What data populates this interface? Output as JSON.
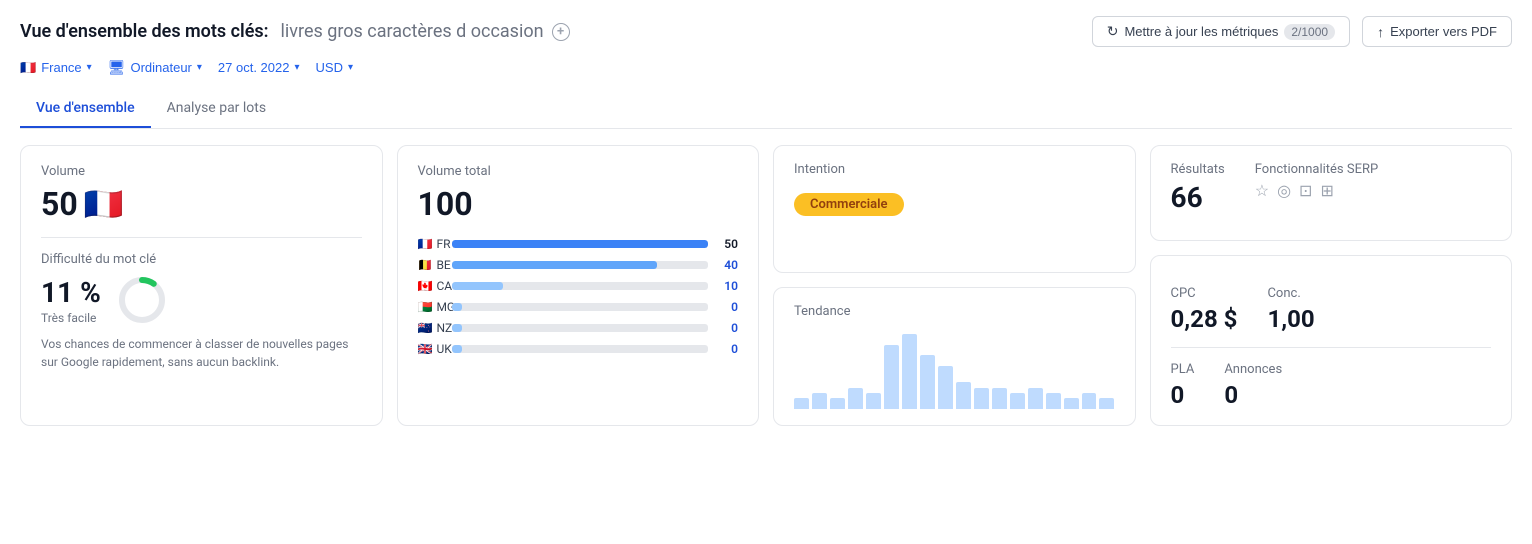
{
  "header": {
    "title_label": "Vue d'ensemble des mots clés:",
    "keyword_query": "livres gros caractères d occasion",
    "update_btn_label": "Mettre à jour les métriques",
    "update_count": "2/1000",
    "export_btn_label": "Exporter vers PDF"
  },
  "filters": {
    "country_label": "France",
    "device_label": "Ordinateur",
    "date_label": "27 oct. 2022",
    "currency_label": "USD"
  },
  "tabs": [
    {
      "id": "overview",
      "label": "Vue d'ensemble",
      "active": true
    },
    {
      "id": "batch",
      "label": "Analyse par lots",
      "active": false
    }
  ],
  "volume_card": {
    "label": "Volume",
    "value": "50"
  },
  "difficulty_card": {
    "label": "Difficulté du mot clé",
    "value": "11 %",
    "sub": "Très facile",
    "description": "Vos chances de commencer à classer de nouvelles pages sur Google rapidement, sans aucun backlink.",
    "percent": 11
  },
  "volume_total_card": {
    "label": "Volume total",
    "value": "100",
    "bars": [
      {
        "code": "FR",
        "flag": "🇫🇷",
        "value": 50,
        "max": 50,
        "num": "50",
        "color": "blue"
      },
      {
        "code": "BE",
        "flag": "🇧🇪",
        "value": 40,
        "max": 50,
        "num": "40",
        "color": "be"
      },
      {
        "code": "CA",
        "flag": "🇨🇦",
        "value": 10,
        "max": 50,
        "num": "10",
        "color": "ca"
      },
      {
        "code": "MG",
        "flag": "🇲🇬",
        "value": 2,
        "max": 50,
        "num": "0",
        "color": "mg"
      },
      {
        "code": "NZ",
        "flag": "🇳🇿",
        "value": 2,
        "max": 50,
        "num": "0",
        "color": "nz"
      },
      {
        "code": "UK",
        "flag": "🇬🇧",
        "value": 2,
        "max": 50,
        "num": "0",
        "color": "uk"
      }
    ]
  },
  "intention_card": {
    "label": "Intention",
    "badge": "Commerciale"
  },
  "tendance_card": {
    "label": "Tendance",
    "bars": [
      2,
      3,
      2,
      4,
      3,
      12,
      14,
      10,
      8,
      5,
      4,
      4,
      3,
      4,
      3,
      2,
      3,
      2
    ]
  },
  "results_card": {
    "results_label": "Résultats",
    "results_value": "66",
    "serp_label": "Fonctionnalités SERP"
  },
  "metrics_card": {
    "cpc_label": "CPC",
    "cpc_value": "0,28 $",
    "conc_label": "Conc.",
    "conc_value": "1,00",
    "pla_label": "PLA",
    "pla_value": "0",
    "annonces_label": "Annonces",
    "annonces_value": "0"
  }
}
